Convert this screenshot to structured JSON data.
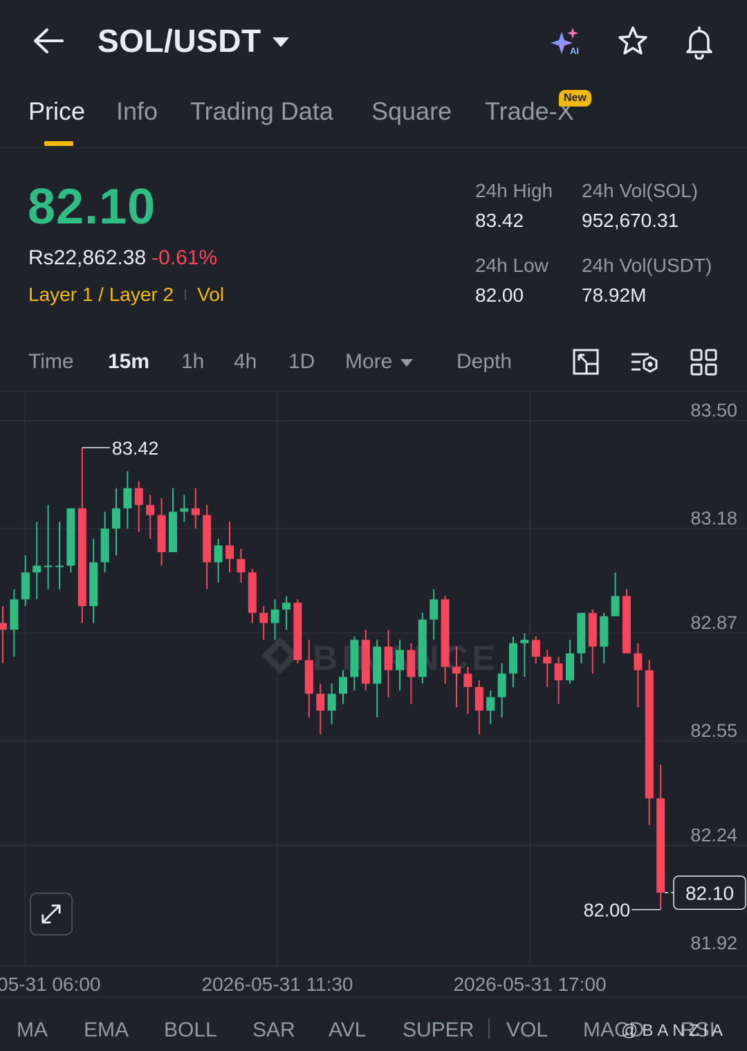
{
  "header": {
    "pair": "SOL/USDT",
    "ai_badge": "AI"
  },
  "tabs": [
    {
      "label": "Price",
      "active": true
    },
    {
      "label": "Info"
    },
    {
      "label": "Trading Data"
    },
    {
      "label": "Square"
    },
    {
      "label": "Trade-X",
      "badge": "New"
    }
  ],
  "ticker": {
    "last_price": "82.10",
    "fiat_price": "Rs22,862.38",
    "change_pct": "-0.61%",
    "tag": "Layer 1 / Layer 2",
    "vol_tag": "Vol",
    "stats": {
      "high_label": "24h High",
      "high": "83.42",
      "vol_sol_label": "24h Vol(SOL)",
      "vol_sol": "952,670.31",
      "low_label": "24h Low",
      "low": "82.00",
      "vol_usdt_label": "24h Vol(USDT)",
      "vol_usdt": "78.92M"
    }
  },
  "intervals": {
    "items": [
      "Time",
      "15m",
      "1h",
      "4h",
      "1D",
      "More",
      "Depth"
    ],
    "active": "15m"
  },
  "colors": {
    "up": "#2ebd85",
    "down": "#f6465d",
    "accent": "#f0b90b",
    "background": "#1f2229"
  },
  "chart_data": {
    "type": "candlestick",
    "y_ticks": [
      "83.50",
      "83.18",
      "82.87",
      "82.55",
      "82.24",
      "81.92"
    ],
    "ylim": [
      81.92,
      83.5
    ],
    "x_ticks": [
      "05-31 06:00",
      "2026-05-31 11:30",
      "2026-05-31 17:00"
    ],
    "last_price_label": "82.10",
    "high_marker": "83.42",
    "low_marker": "82.00",
    "watermark": "BINANCE",
    "candles": [
      [
        82.9,
        82.95,
        82.78,
        82.88
      ],
      [
        82.88,
        83.0,
        82.8,
        82.97
      ],
      [
        82.97,
        83.1,
        82.95,
        83.05
      ],
      [
        83.05,
        83.2,
        82.97,
        83.07
      ],
      [
        83.07,
        83.25,
        83.0,
        83.07
      ],
      [
        83.07,
        83.2,
        83.0,
        83.07
      ],
      [
        83.07,
        83.24,
        83.05,
        83.24
      ],
      [
        83.24,
        83.42,
        82.9,
        82.95
      ],
      [
        82.95,
        83.15,
        82.9,
        83.08
      ],
      [
        83.08,
        83.23,
        83.05,
        83.18
      ],
      [
        83.18,
        83.3,
        83.1,
        83.24
      ],
      [
        83.24,
        83.35,
        83.18,
        83.3
      ],
      [
        83.3,
        83.32,
        83.17,
        83.25
      ],
      [
        83.25,
        83.28,
        83.15,
        83.22
      ],
      [
        83.22,
        83.27,
        83.07,
        83.11
      ],
      [
        83.11,
        83.3,
        83.11,
        83.23
      ],
      [
        83.23,
        83.28,
        83.2,
        83.24
      ],
      [
        83.24,
        83.3,
        83.18,
        83.22
      ],
      [
        83.22,
        83.25,
        83.0,
        83.08
      ],
      [
        83.08,
        83.15,
        83.02,
        83.13
      ],
      [
        83.13,
        83.2,
        83.05,
        83.09
      ],
      [
        83.09,
        83.12,
        83.02,
        83.05
      ],
      [
        83.05,
        83.06,
        82.9,
        82.93
      ],
      [
        82.93,
        82.95,
        82.85,
        82.9
      ],
      [
        82.9,
        82.97,
        82.85,
        82.94
      ],
      [
        82.94,
        82.98,
        82.88,
        82.96
      ],
      [
        82.96,
        82.97,
        82.78,
        82.79
      ],
      [
        82.79,
        82.85,
        82.62,
        82.69
      ],
      [
        82.69,
        82.72,
        82.57,
        82.64
      ],
      [
        82.64,
        82.72,
        82.6,
        82.69
      ],
      [
        82.69,
        82.76,
        82.66,
        82.74
      ],
      [
        82.74,
        82.86,
        82.7,
        82.85
      ],
      [
        82.85,
        82.88,
        82.7,
        82.72
      ],
      [
        82.72,
        82.85,
        82.62,
        82.83
      ],
      [
        82.83,
        82.88,
        82.68,
        82.76
      ],
      [
        82.76,
        82.85,
        82.7,
        82.82
      ],
      [
        82.82,
        82.84,
        82.66,
        82.74
      ],
      [
        82.74,
        82.93,
        82.72,
        82.91
      ],
      [
        82.91,
        83.0,
        82.85,
        82.97
      ],
      [
        82.97,
        82.98,
        82.72,
        82.77
      ],
      [
        82.77,
        82.83,
        82.65,
        82.75
      ],
      [
        82.75,
        82.77,
        82.63,
        82.71
      ],
      [
        82.71,
        82.73,
        82.57,
        82.64
      ],
      [
        82.64,
        82.7,
        82.6,
        82.68
      ],
      [
        82.68,
        82.78,
        82.62,
        82.75
      ],
      [
        82.75,
        82.86,
        82.71,
        82.84
      ],
      [
        82.84,
        82.87,
        82.74,
        82.85
      ],
      [
        82.85,
        82.86,
        82.78,
        82.8
      ],
      [
        82.8,
        82.82,
        82.71,
        82.78
      ],
      [
        82.78,
        82.8,
        82.66,
        82.73
      ],
      [
        82.73,
        82.85,
        82.72,
        82.81
      ],
      [
        82.81,
        82.93,
        82.78,
        82.93
      ],
      [
        82.93,
        82.94,
        82.75,
        82.83
      ],
      [
        82.83,
        82.93,
        82.78,
        82.92
      ],
      [
        82.92,
        83.05,
        82.92,
        82.98
      ],
      [
        82.98,
        83.0,
        82.83,
        82.81
      ],
      [
        82.81,
        82.84,
        82.65,
        82.76
      ],
      [
        82.76,
        82.79,
        82.3,
        82.38
      ],
      [
        82.38,
        82.48,
        82.05,
        82.1
      ]
    ]
  },
  "indicators": [
    "MA",
    "EMA",
    "BOLL",
    "SAR",
    "AVL",
    "SUPER",
    "VOL",
    "MACD",
    "RSI"
  ],
  "footer_mark": "@BANZIA"
}
